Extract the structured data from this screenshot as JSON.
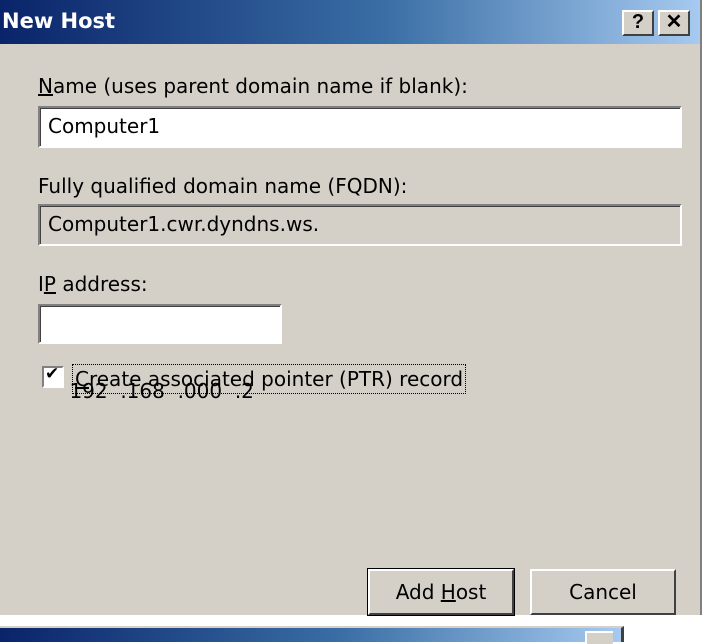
{
  "window": {
    "title": "New Host",
    "help_button": "?",
    "close_button": "✕"
  },
  "name_field": {
    "label_mnemonic": "N",
    "label_rest": "ame (uses parent domain name if blank):",
    "value": "Computer1"
  },
  "fqdn_field": {
    "label": "Fully qualified domain name (FQDN):",
    "value": "Computer1.cwr.dyndns.ws."
  },
  "ip_field": {
    "label_pre": "I",
    "label_mnemonic": "P",
    "label_rest": " address:",
    "value": "192  .168  .000  .2"
  },
  "ptr_checkbox": {
    "checked": true,
    "check_glyph": "✔",
    "label_mnemonic": "C",
    "label_rest": "reate associated pointer (PTR) record"
  },
  "buttons": {
    "add_host_pre": "Add ",
    "add_host_mnemonic": "H",
    "add_host_rest": "ost",
    "cancel": "Cancel"
  }
}
